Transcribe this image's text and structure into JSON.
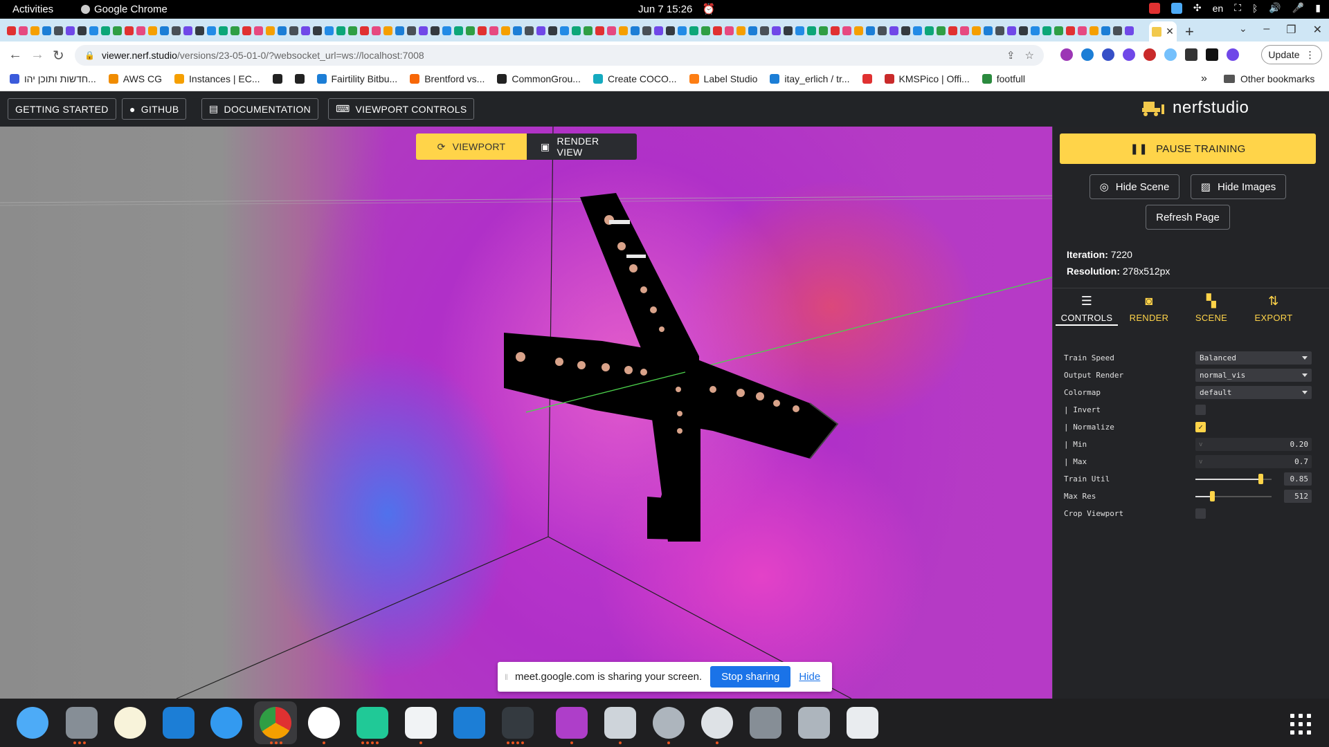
{
  "system": {
    "activities": "Activities",
    "app_name": "Google Chrome",
    "clock": "Jun 7  15:26",
    "language": "en"
  },
  "browser": {
    "url_host": "viewer.nerf.studio",
    "url_path": "/versions/23-05-01-0/?websocket_url=ws://localhost:7008",
    "update_label": "Update",
    "bookmarks": [
      {
        "label": "חדשות ותוכן יהו...",
        "color": "#3b5bdb"
      },
      {
        "label": "AWS CG",
        "color": "#f08c00"
      },
      {
        "label": "Instances | EC...",
        "color": "#f59f00"
      },
      {
        "label": "",
        "color": "#222222"
      },
      {
        "label": "",
        "color": "#222222"
      },
      {
        "label": "Fairtility Bitbu...",
        "color": "#1c7ed6"
      },
      {
        "label": "Brentford vs...",
        "color": "#f76707"
      },
      {
        "label": "CommonGrou...",
        "color": "#222222"
      },
      {
        "label": "Create COCO...",
        "color": "#15aabf"
      },
      {
        "label": "Label Studio",
        "color": "#fd7e14"
      },
      {
        "label": "itay_erlich / tr...",
        "color": "#1c7ed6"
      },
      {
        "label": "",
        "color": "#e03131"
      },
      {
        "label": "KMSPico | Offi...",
        "color": "#c92a2a"
      },
      {
        "label": "footfull",
        "color": "#2b8a3e"
      }
    ],
    "other_bookmarks": "Other bookmarks"
  },
  "nerfstudio": {
    "header_buttons": {
      "getting_started": "GETTING STARTED",
      "github": "GITHUB",
      "documentation": "DOCUMENTATION",
      "viewport_controls": "VIEWPORT CONTROLS"
    },
    "logo_text": "nerfstudio",
    "viewport_tabs": {
      "viewport": "VIEWPORT",
      "render_view": "RENDER VIEW"
    },
    "panel": {
      "pause_training": "PAUSE TRAINING",
      "hide_scene": "Hide Scene",
      "hide_images": "Hide Images",
      "refresh_page": "Refresh Page",
      "iteration_label": "Iteration:",
      "iteration_value": "7220",
      "resolution_label": "Resolution:",
      "resolution_value": "278x512px",
      "tabs": {
        "controls": "CONTROLS",
        "render": "RENDER",
        "scene": "SCENE",
        "export": "EXPORT"
      },
      "controls": {
        "train_speed_label": "Train Speed",
        "train_speed_value": "Balanced",
        "output_render_label": "Output Render",
        "output_render_value": "normal_vis",
        "colormap_label": "Colormap",
        "colormap_value": "default",
        "invert_label": "| Invert",
        "invert_checked": false,
        "normalize_label": "| Normalize",
        "normalize_checked": true,
        "min_label": "| Min",
        "min_value": "0.20",
        "max_label": "| Max",
        "max_value": "0.7",
        "train_util_label": "Train Util",
        "train_util_value": "0.85",
        "train_util_fraction": 0.85,
        "max_res_label": "Max Res",
        "max_res_value": "512",
        "max_res_fraction": 0.22,
        "crop_viewport_label": "Crop Viewport",
        "crop_viewport_checked": false
      }
    }
  },
  "screen_share": {
    "text": "meet.google.com is sharing your screen.",
    "stop_label": "Stop sharing",
    "hide_label": "Hide"
  },
  "colors": {
    "accent": "#ffd449",
    "panel_bg": "#232427",
    "share_blue": "#1a73e8"
  }
}
